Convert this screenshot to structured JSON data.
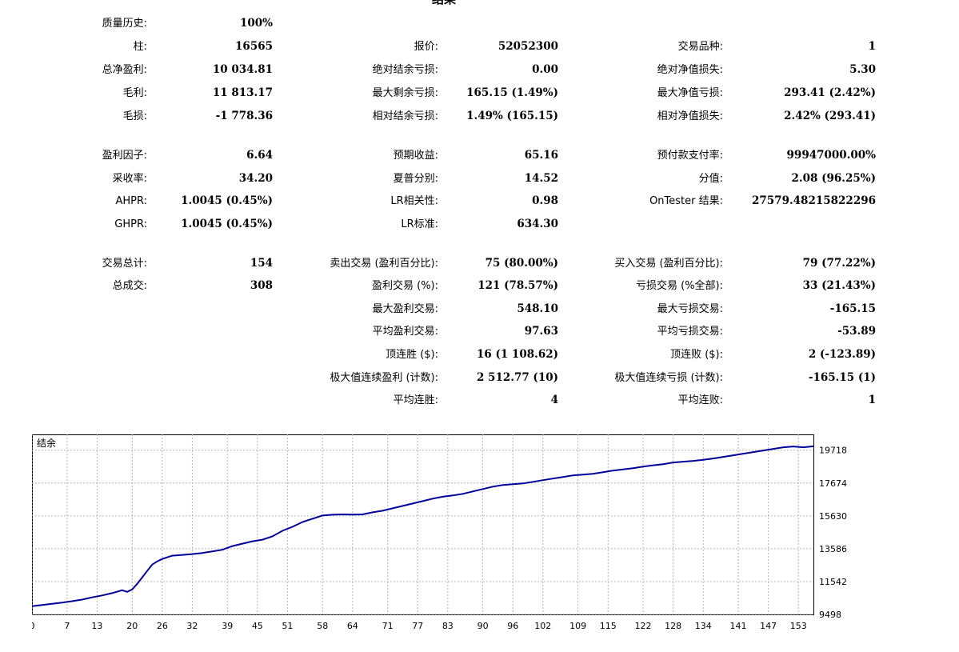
{
  "report": {
    "title": "结果"
  },
  "rows": [
    {
      "top": 0,
      "cells": [
        {
          "label": "质量历史:",
          "value": "100%"
        },
        null,
        null
      ]
    },
    {
      "top": 1,
      "cells": [
        {
          "label": "柱:",
          "value": "16565"
        },
        {
          "label": "报价:",
          "value": "52052300"
        },
        {
          "label": "交易品种:",
          "value": "1"
        }
      ]
    },
    {
      "top": 2,
      "cells": [
        {
          "label": "总净盈利:",
          "value": "10 034.81"
        },
        {
          "label": "绝对结余亏损:",
          "value": "0.00"
        },
        {
          "label": "绝对净值损失:",
          "value": "5.30"
        }
      ]
    },
    {
      "top": 3,
      "cells": [
        {
          "label": "毛利:",
          "value": "11 813.17"
        },
        {
          "label": "最大剩余亏损:",
          "value": "165.15 (1.49%)"
        },
        {
          "label": "最大净值亏损:",
          "value": "293.41 (2.42%)"
        }
      ]
    },
    {
      "top": 4,
      "cells": [
        {
          "label": "毛损:",
          "value": "-1 778.36"
        },
        {
          "label": "相对结余亏损:",
          "value": "1.49% (165.15)"
        },
        {
          "label": "相对净值损失:",
          "value": "2.42% (293.41)"
        }
      ]
    },
    {
      "top": 5,
      "cells": [
        {
          "label": "盈利因子:",
          "value": "6.64"
        },
        {
          "label": "预期收益:",
          "value": "65.16"
        },
        {
          "label": "预付款支付率:",
          "value": "99947000.00%"
        }
      ]
    },
    {
      "top": 6,
      "cells": [
        {
          "label": "采收率:",
          "value": "34.20"
        },
        {
          "label": "夏普分别:",
          "value": "14.52"
        },
        {
          "label": "分值:",
          "value": "2.08 (96.25%)"
        }
      ]
    },
    {
      "top": 7,
      "cells": [
        {
          "label": "AHPR:",
          "value": "1.0045 (0.45%)"
        },
        {
          "label": "LR相关性:",
          "value": "0.98"
        },
        {
          "label": "OnTester 结果:",
          "value": "27579.48215822296"
        }
      ]
    },
    {
      "top": 8,
      "cells": [
        {
          "label": "GHPR:",
          "value": "1.0045 (0.45%)"
        },
        {
          "label": "LR标准:",
          "value": "634.30"
        },
        null
      ]
    },
    {
      "top": 9,
      "cells": [
        {
          "label": "交易总计:",
          "value": "154"
        },
        {
          "label": "卖出交易 (盈利百分比):",
          "value": "75 (80.00%)"
        },
        {
          "label": "买入交易 (盈利百分比):",
          "value": "79 (77.22%)"
        }
      ]
    },
    {
      "top": 10,
      "cells": [
        {
          "label": "总成交:",
          "value": "308"
        },
        {
          "label": "盈利交易 (%):",
          "value": "121 (78.57%)"
        },
        {
          "label": "亏损交易 (%全部):",
          "value": "33 (21.43%)"
        }
      ]
    },
    {
      "top": 11,
      "cells": [
        null,
        {
          "label": "最大盈利交易:",
          "value": "548.10"
        },
        {
          "label": "最大亏损交易:",
          "value": "-165.15"
        }
      ]
    },
    {
      "top": 12,
      "cells": [
        null,
        {
          "label": "平均盈利交易:",
          "value": "97.63"
        },
        {
          "label": "平均亏损交易:",
          "value": "-53.89"
        }
      ]
    },
    {
      "top": 13,
      "cells": [
        null,
        {
          "label": "顶连胜 ($):",
          "value": "16 (1 108.62)"
        },
        {
          "label": "顶连败 ($):",
          "value": "2 (-123.89)"
        }
      ]
    },
    {
      "top": 14,
      "cells": [
        null,
        {
          "label": "极大值连续盈利 (计数):",
          "value": "2 512.77 (10)"
        },
        {
          "label": "极大值连续亏损 (计数):",
          "value": "-165.15 (1)"
        }
      ]
    },
    {
      "top": 15,
      "cells": [
        null,
        {
          "label": "平均连胜:",
          "value": "4"
        },
        {
          "label": "平均连败:",
          "value": "1"
        }
      ]
    }
  ],
  "chart_data": {
    "type": "line",
    "title": "结余",
    "ylim": [
      9498,
      20700
    ],
    "xlim": [
      0,
      156
    ],
    "yticks": [
      9498,
      11542,
      13586,
      15630,
      17674,
      19718
    ],
    "xticks": [
      0,
      7,
      13,
      20,
      26,
      32,
      39,
      45,
      51,
      58,
      64,
      71,
      77,
      83,
      90,
      96,
      102,
      109,
      115,
      122,
      128,
      134,
      141,
      147,
      153
    ],
    "grid": true,
    "color": "#00009c",
    "series": [
      {
        "x": [
          0,
          2,
          4,
          6,
          8,
          10,
          12,
          14,
          16,
          18,
          19,
          20,
          21,
          22,
          23,
          24,
          25,
          26,
          28,
          30,
          32,
          34,
          36,
          38,
          40,
          42,
          44,
          46,
          48,
          50,
          52,
          54,
          56,
          58,
          60,
          62,
          64,
          66,
          68,
          70,
          72,
          74,
          76,
          78,
          80,
          82,
          84,
          86,
          88,
          90,
          92,
          94,
          96,
          98,
          100,
          102,
          104,
          106,
          108,
          110,
          112,
          114,
          116,
          118,
          120,
          122,
          124,
          126,
          128,
          130,
          132,
          134,
          136,
          138,
          140,
          142,
          144,
          146,
          148,
          150,
          152,
          154,
          156
        ],
        "values": [
          10010,
          10080,
          10160,
          10230,
          10320,
          10420,
          10560,
          10680,
          10820,
          11000,
          10900,
          11050,
          11400,
          11800,
          12200,
          12600,
          12800,
          12950,
          13150,
          13200,
          13250,
          13320,
          13420,
          13520,
          13750,
          13900,
          14050,
          14150,
          14350,
          14700,
          14950,
          15250,
          15450,
          15650,
          15700,
          15720,
          15710,
          15720,
          15850,
          15950,
          16100,
          16250,
          16400,
          16550,
          16700,
          16820,
          16900,
          17000,
          17150,
          17300,
          17450,
          17550,
          17600,
          17650,
          17750,
          17850,
          17950,
          18050,
          18150,
          18200,
          18250,
          18350,
          18450,
          18520,
          18600,
          18700,
          18780,
          18850,
          18950,
          19000,
          19050,
          19120,
          19200,
          19300,
          19400,
          19500,
          19600,
          19700,
          19800,
          19900,
          19950,
          19900,
          19960
        ]
      }
    ]
  }
}
